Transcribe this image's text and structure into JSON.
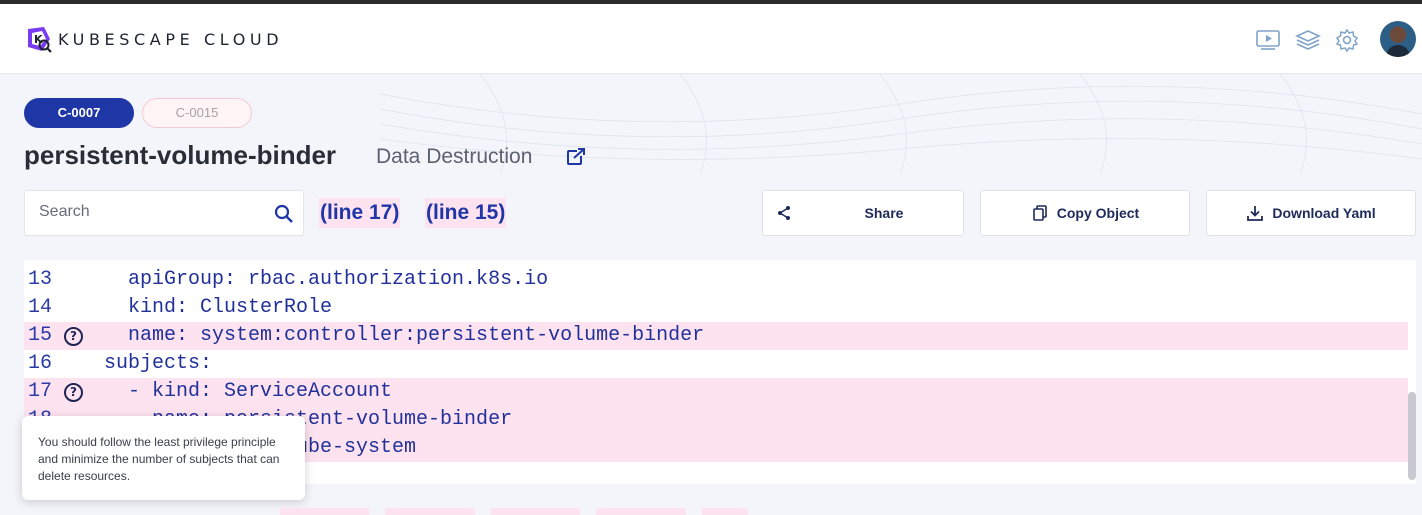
{
  "app": {
    "brand": "KUBESCAPE CLOUD"
  },
  "header": {
    "icons": [
      "presentation-icon",
      "layers-icon",
      "settings-icon"
    ],
    "avatar_label": "user-avatar"
  },
  "controls": [
    {
      "label": "C-0007",
      "active": true
    },
    {
      "label": "C-0015",
      "active": false
    }
  ],
  "resource": {
    "name": "persistent-volume-binder",
    "category": "Data Destruction"
  },
  "search": {
    "placeholder": "Search",
    "value": ""
  },
  "line_links": [
    "(line 17)",
    "(line 15)"
  ],
  "actions": {
    "share_label": "Share",
    "copy_label": "Copy Object",
    "download_label": "Download Yaml"
  },
  "code": {
    "lines": [
      {
        "num": "13",
        "text": "  apiGroup: rbac.authorization.k8s.io",
        "highlight": false,
        "help": false
      },
      {
        "num": "14",
        "text": "  kind: ClusterRole",
        "highlight": false,
        "help": false
      },
      {
        "num": "15",
        "text": "  name: system:controller:persistent-volume-binder",
        "highlight": true,
        "help": true
      },
      {
        "num": "16",
        "text": "subjects:",
        "highlight": false,
        "help": false
      },
      {
        "num": "17",
        "text": "  - kind: ServiceAccount",
        "highlight": true,
        "help": true
      },
      {
        "num": "18",
        "text": "    name: persistent-volume-binder",
        "highlight": true,
        "help": false
      },
      {
        "num": "",
        "text": "    namespace: kube-system",
        "highlight": true,
        "help": false
      }
    ]
  },
  "tooltip": {
    "text": "You should follow the least privilege principle and minimize the number of subjects that can delete resources."
  },
  "colors": {
    "accent": "#1f36a6",
    "highlight": "#fde3ef",
    "code_text": "#22309a"
  }
}
